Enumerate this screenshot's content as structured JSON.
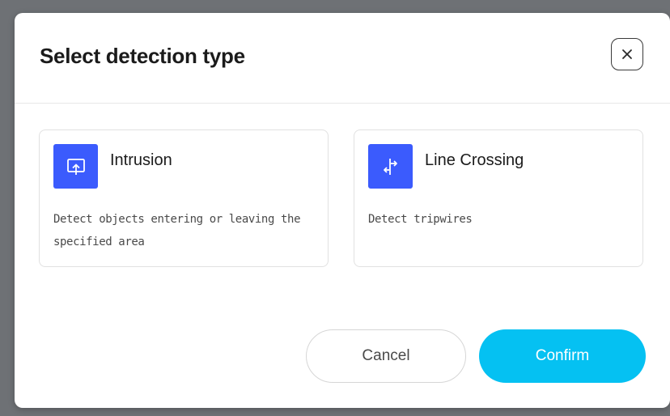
{
  "dialog": {
    "title": "Select detection type",
    "close_icon": "close-icon"
  },
  "options": [
    {
      "title": "Intrusion",
      "description": "Detect objects entering or leaving the specified area",
      "icon": "area-upload-icon"
    },
    {
      "title": "Line Crossing",
      "description": "Detect tripwires",
      "icon": "tripwire-arrows-icon"
    }
  ],
  "buttons": {
    "cancel": "Cancel",
    "confirm": "Confirm"
  },
  "colors": {
    "accent_blue": "#3b5bfd",
    "confirm_cyan": "#05c1f2",
    "backdrop": "#6e7175"
  }
}
